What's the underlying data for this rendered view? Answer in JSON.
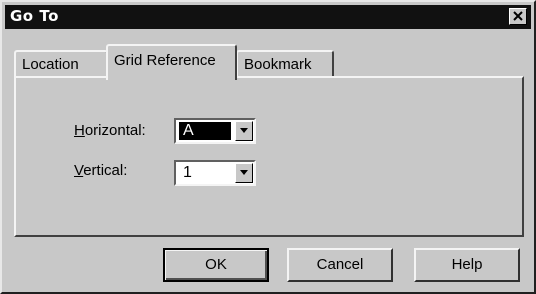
{
  "window": {
    "title": "Go To",
    "close_icon": "close-icon"
  },
  "tabs": [
    {
      "label": "Location",
      "active": false
    },
    {
      "label": "Grid Reference",
      "active": true
    },
    {
      "label": "Bookmark",
      "active": false
    }
  ],
  "fields": {
    "horizontal": {
      "label_underlined": "H",
      "label_rest": "orizontal:",
      "value": "A"
    },
    "vertical": {
      "label_underlined": "V",
      "label_rest": "ertical:",
      "value": "1"
    }
  },
  "buttons": {
    "ok": "OK",
    "cancel": "Cancel",
    "help": "Help"
  },
  "colors": {
    "titlebar": "#111111",
    "face": "#c8c8c8",
    "selection": "#000000"
  }
}
